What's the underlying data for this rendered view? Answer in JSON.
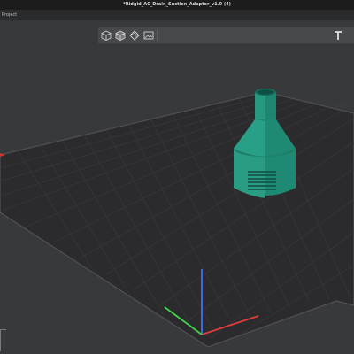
{
  "window": {
    "title": "*Ridgid_AC_Drain_Suction_Adaptor_v1.0 (4)"
  },
  "menu": {
    "project_label": "Project"
  },
  "toolbar": {
    "tools": [
      "cube-view-icon",
      "shaded-cube-view-icon",
      "layers-view-icon",
      "image-view-icon"
    ],
    "right_tool": "text-tool-icon"
  },
  "viewport": {
    "bed_color": "#2b2b2d",
    "grid_color": "#3d3e41",
    "model_color": "#1f8a74",
    "axis_colors": {
      "x": "#e23b3b",
      "y": "#3fd24a",
      "z": "#3a73ff"
    }
  }
}
